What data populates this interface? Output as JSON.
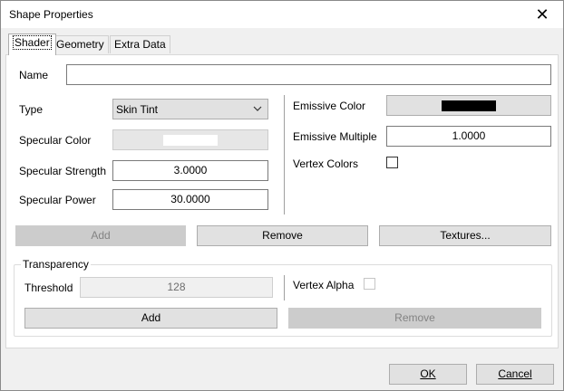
{
  "window": {
    "title": "Shape Properties"
  },
  "tabs": [
    {
      "label": "Shader",
      "active": true
    },
    {
      "label": "Geometry",
      "active": false
    },
    {
      "label": "Extra Data",
      "active": false
    }
  ],
  "shader": {
    "name_label": "Name",
    "name_value": "",
    "type_label": "Type",
    "type_value": "Skin Tint",
    "specular_color_label": "Specular Color",
    "specular_color": "#ffffff",
    "specular_strength_label": "Specular Strength",
    "specular_strength_value": "3.0000",
    "specular_power_label": "Specular Power",
    "specular_power_value": "30.0000",
    "emissive_color_label": "Emissive Color",
    "emissive_color": "#000000",
    "emissive_multiple_label": "Emissive Multiple",
    "emissive_multiple_value": "1.0000",
    "vertex_colors_label": "Vertex Colors",
    "vertex_colors_checked": false,
    "add_label": "Add",
    "remove_label": "Remove",
    "textures_label": "Textures..."
  },
  "transparency": {
    "group_title": "Transparency",
    "threshold_label": "Threshold",
    "threshold_value": "128",
    "vertex_alpha_label": "Vertex Alpha",
    "vertex_alpha_checked": false,
    "add_label": "Add",
    "remove_label": "Remove"
  },
  "footer": {
    "ok_label": "OK",
    "cancel_label": "Cancel"
  }
}
